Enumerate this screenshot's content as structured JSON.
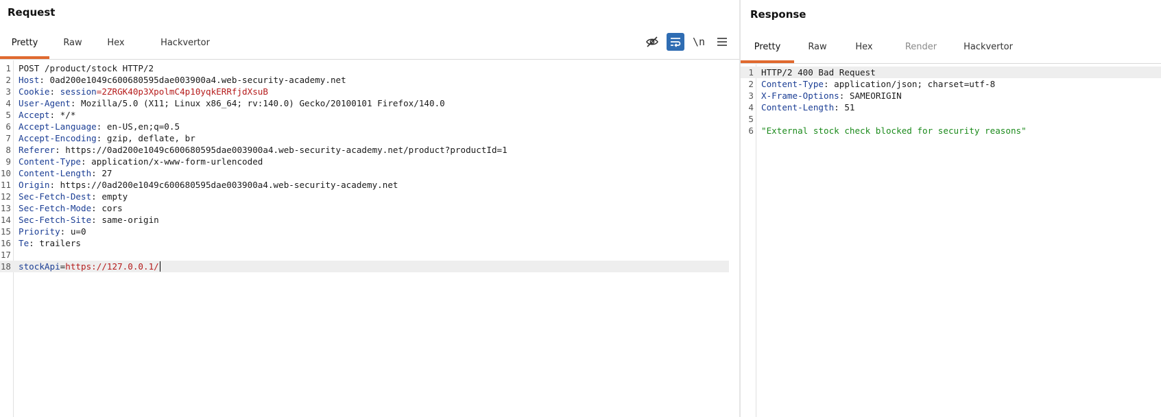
{
  "request": {
    "title": "Request",
    "tabs": [
      "Pretty",
      "Raw",
      "Hex",
      "Hackvertor"
    ],
    "active_tab": "Pretty",
    "toolbar": {
      "hide_icon": "eye-off-icon",
      "wrap_icon": "wrap-icon",
      "newline_label": "\\n",
      "menu_icon": "hamburger-icon"
    },
    "lines": [
      {
        "n": "1",
        "key": "POST /product/stock HTTP/2",
        "sep": "",
        "val": ""
      },
      {
        "n": "2",
        "key": "Host",
        "sep": ": ",
        "val": "0ad200e1049c600680595dae003900a4.web-security-academy.net"
      },
      {
        "n": "3",
        "key": "Cookie",
        "sep": ": ",
        "val": ""
      },
      {
        "n": "4",
        "key": "User-Agent",
        "sep": ": ",
        "val": "Mozilla/5.0 (X11; Linux x86_64; rv:140.0) Gecko/20100101 Firefox/140.0"
      },
      {
        "n": "5",
        "key": "Accept",
        "sep": ": ",
        "val": "*/*"
      },
      {
        "n": "6",
        "key": "Accept-Language",
        "sep": ": ",
        "val": "en-US,en;q=0.5"
      },
      {
        "n": "7",
        "key": "Accept-Encoding",
        "sep": ": ",
        "val": "gzip, deflate, br"
      },
      {
        "n": "8",
        "key": "Referer",
        "sep": ": ",
        "val": "https://0ad200e1049c600680595dae003900a4.web-security-academy.net/product?productId=1"
      },
      {
        "n": "9",
        "key": "Content-Type",
        "sep": ": ",
        "val": "application/x-www-form-urlencoded"
      },
      {
        "n": "10",
        "key": "Content-Length",
        "sep": ": ",
        "val": "27"
      },
      {
        "n": "11",
        "key": "Origin",
        "sep": ": ",
        "val": "https://0ad200e1049c600680595dae003900a4.web-security-academy.net"
      },
      {
        "n": "12",
        "key": "Sec-Fetch-Dest",
        "sep": ": ",
        "val": "empty"
      },
      {
        "n": "13",
        "key": "Sec-Fetch-Mode",
        "sep": ": ",
        "val": "cors"
      },
      {
        "n": "14",
        "key": "Sec-Fetch-Site",
        "sep": ": ",
        "val": "same-origin"
      },
      {
        "n": "15",
        "key": "Priority",
        "sep": ": ",
        "val": "u=0"
      },
      {
        "n": "16",
        "key": "Te",
        "sep": ": ",
        "val": "trailers"
      },
      {
        "n": "17",
        "key": "",
        "sep": "",
        "val": ""
      },
      {
        "n": "18",
        "key": "stockApi",
        "sep": "=",
        "val": ""
      }
    ],
    "cookie": {
      "name": "session",
      "eq": "=",
      "value": "2ZRGK40p3XpolmC4p10yqkERRfjdXsuB"
    },
    "body_value": "https://127.0.0.1/"
  },
  "response": {
    "title": "Response",
    "tabs": [
      "Pretty",
      "Raw",
      "Hex",
      "Render",
      "Hackvertor"
    ],
    "active_tab": "Pretty",
    "lines": [
      {
        "n": "1",
        "key": "HTTP/2 400 Bad Request",
        "sep": "",
        "val": ""
      },
      {
        "n": "2",
        "key": "Content-Type",
        "sep": ": ",
        "val": "application/json; charset=utf-8"
      },
      {
        "n": "3",
        "key": "X-Frame-Options",
        "sep": ": ",
        "val": "SAMEORIGIN"
      },
      {
        "n": "4",
        "key": "Content-Length",
        "sep": ": ",
        "val": "51"
      },
      {
        "n": "5",
        "key": "",
        "sep": "",
        "val": ""
      },
      {
        "n": "6",
        "key": "",
        "sep": "",
        "val": ""
      }
    ],
    "body": "\"External stock check blocked for security reasons\""
  },
  "colors": {
    "accent": "#e06a2f",
    "header_key": "#1a3d94",
    "cookie_value": "#b51b1b",
    "json_string": "#1b8a1b",
    "toggle_on": "#2f6db3"
  }
}
